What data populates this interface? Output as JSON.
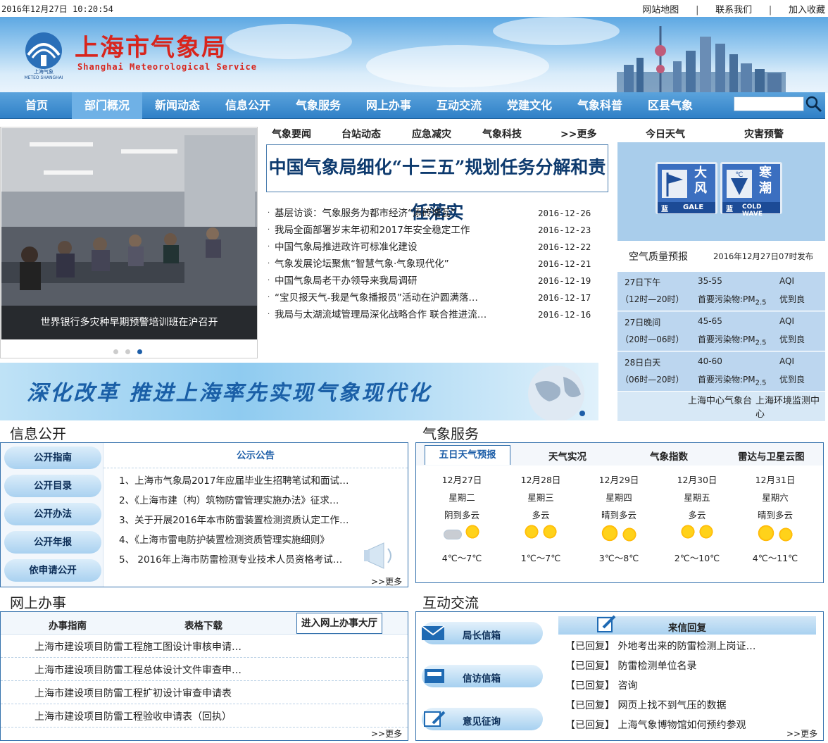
{
  "topbar": {
    "datetime": "2016年12月27日 10:20:54",
    "links": [
      "网站地图",
      "联系我们",
      "加入收藏"
    ],
    "sep": "|"
  },
  "header": {
    "title_cn": "上海市气象局",
    "title_en": "Shanghai Meteorological Service",
    "logo_top": "上海气象",
    "logo_bottom": "METEO SHANGHAI"
  },
  "nav": {
    "items": [
      "首页",
      "部门概况",
      "新闻动态",
      "信息公开",
      "气象服务",
      "网上办事",
      "互动交流",
      "党建文化",
      "气象科普",
      "区县气象"
    ],
    "search_value": ""
  },
  "slider": {
    "caption": "世界银行多灾种早期预警培训班在沪召开",
    "active_dot": 3
  },
  "news": {
    "tabs": [
      "气象要闻",
      "台站动态",
      "应急减灾",
      "气象科技",
      ">>更多"
    ],
    "headline": "中国气象局细化“十三五”规划任务分解和责任落实",
    "items": [
      {
        "title": "基层访谈：气象服务为都市经济“添砖增瓦”",
        "date": "2016-12-26"
      },
      {
        "title": "我局全面部署岁末年初和2017年安全稳定工作",
        "date": "2016-12-23"
      },
      {
        "title": "中国气象局推进政许可标准化建设",
        "date": "2016-12-22"
      },
      {
        "title": "气象发展论坛聚焦“智慧气象·气象现代化”",
        "date": "2016-12-21"
      },
      {
        "title": "中国气象局老干办领导来我局调研",
        "date": "2016-12-19"
      },
      {
        "title": "“宝贝报天气-我是气象播报员”活动在沪圆满落…",
        "date": "2016-12-17"
      },
      {
        "title": "我局与太湖流域管理局深化战略合作 联合推进流…",
        "date": "2016-12-16"
      }
    ]
  },
  "banner": {
    "text": "深化改革 推进上海率先实现气象现代化"
  },
  "weather": {
    "tabs": [
      "今日天气",
      "灾害预警"
    ],
    "warnings": [
      {
        "big": [
          "大",
          "风"
        ],
        "level": "蓝",
        "en": "GALE"
      },
      {
        "big": [
          "寒",
          "潮"
        ],
        "level": "蓝",
        "en": "COLD WAVE"
      }
    ],
    "aq_title": "空气质量预报",
    "aq_published": "2016年12月27日07时发布",
    "aq_rows": [
      {
        "period": "27日下午",
        "hours": "（12时—20时）",
        "range": "35-55",
        "pollutant_label": "首要污染物:",
        "pollutant": "PM",
        "sub": "2.5",
        "aqi": "AQI",
        "level": "优到良"
      },
      {
        "period": "27日晚间",
        "hours": "（20时—06时）",
        "range": "45-65",
        "pollutant_label": "首要污染物:",
        "pollutant": "PM",
        "sub": "2.5",
        "aqi": "AQI",
        "level": "优到良"
      },
      {
        "period": "28日白天",
        "hours": "（06时—20时）",
        "range": "40-60",
        "pollutant_label": "首要污染物:",
        "pollutant": "PM",
        "sub": "2.5",
        "aqi": "AQI",
        "level": "优到良"
      }
    ],
    "links": [
      "上海中心气象台",
      "上海环境监测中心"
    ]
  },
  "info": {
    "title": "信息公开",
    "pills": [
      "公开指南",
      "公开目录",
      "公开办法",
      "公开年报",
      "依申请公开"
    ],
    "notice_title": "公示公告",
    "notices": [
      "1、上海市气象局2017年应届毕业生招聘笔试和面试…",
      "2、《上海市建（构）筑物防雷管理实施办法》征求…",
      "3、关于开展2016年本市防雷装置检测资质认定工作…",
      "4、《上海市雷电防护装置检测资质管理实施细则》",
      "5、 2016年上海市防雷检测专业技术人员资格考试…"
    ],
    "more": ">>更多"
  },
  "service": {
    "title": "气象服务",
    "tabs": [
      "五日天气预报",
      "天气实况",
      "气象指数",
      "雷达与卫星云图"
    ],
    "days": [
      {
        "date": "12月27日",
        "week": "星期二",
        "desc": "阴到多云",
        "temp": "4℃～7℃",
        "icon1": "overcast-icon",
        "icon2": "partly-cloudy-icon"
      },
      {
        "date": "12月28日",
        "week": "星期三",
        "desc": "多云",
        "temp": "1℃～7℃",
        "icon1": "partly-cloudy-icon",
        "icon2": "partly-cloudy-icon"
      },
      {
        "date": "12月29日",
        "week": "星期四",
        "desc": "晴到多云",
        "temp": "3℃～8℃",
        "icon1": "sunny-icon",
        "icon2": "partly-cloudy-icon"
      },
      {
        "date": "12月30日",
        "week": "星期五",
        "desc": "多云",
        "temp": "2℃～10℃",
        "icon1": "partly-cloudy-icon",
        "icon2": "partly-cloudy-icon"
      },
      {
        "date": "12月31日",
        "week": "星期六",
        "desc": "晴到多云",
        "temp": "4℃～11℃",
        "icon1": "sunny-icon",
        "icon2": "partly-cloudy-icon"
      }
    ]
  },
  "online": {
    "title": "网上办事",
    "tabs": [
      "办事指南",
      "表格下载",
      "进入网上办事大厅"
    ],
    "items": [
      "上海市建设项目防雷工程施工图设计审核申请…",
      "上海市建设项目防雷工程总体设计文件审查申…",
      "上海市建设项目防雷工程扩初设计审查申请表",
      "上海市建设项目防雷工程验收申请表（回执）"
    ],
    "more": ">>更多"
  },
  "interact": {
    "title": "互动交流",
    "pills": [
      "局长信箱",
      "信访信箱",
      "意见征询"
    ],
    "reply_title": "来信回复",
    "replies": [
      {
        "tag": "【已回复】",
        "text": "外地考出来的防雷检测上岗证…"
      },
      {
        "tag": "【已回复】",
        "text": "防雷检测单位名录"
      },
      {
        "tag": "【已回复】",
        "text": "咨询"
      },
      {
        "tag": "【已回复】",
        "text": "网页上找不到气压的数据"
      },
      {
        "tag": "【已回复】",
        "text": "上海气象博物馆如何预约参观"
      }
    ],
    "more": ">>更多"
  },
  "colors": {
    "nav": "#2f80c7",
    "brand_red": "#d8251d",
    "border": "#3572ad",
    "panel": "#d7e8f6"
  }
}
